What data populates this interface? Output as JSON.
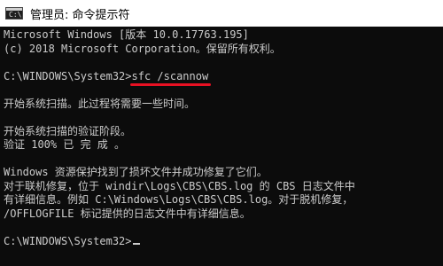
{
  "window": {
    "title": "管理员: 命令提示符",
    "icon": "console-icon",
    "icon_glyph": "C:\\"
  },
  "console": {
    "lines": [
      "Microsoft Windows [版本 10.0.17763.195]",
      "(c) 2018 Microsoft Corporation。保留所有权利。",
      "",
      "",
      "开始系统扫描。此过程将需要一些时间。",
      "",
      "开始系统扫描的验证阶段。",
      "验证 100% 已 完 成 。",
      "",
      "Windows 资源保护找到了损坏文件并成功修复了它们。",
      "对于联机修复，位于 windir\\Logs\\CBS\\CBS.log 的 CBS 日志文件中",
      "有详细信息。例如 C:\\Windows\\Logs\\CBS\\CBS.log。对于脱机修复，",
      "/OFFLOGFILE 标记提供的日志文件中有详细信息。",
      ""
    ],
    "command_prompt": "C:\\WINDOWS\\System32>",
    "command": "sfc /scannow",
    "final_prompt": "C:\\WINDOWS\\System32>"
  },
  "colors": {
    "background": "#0c0c0c",
    "text": "#cccccc",
    "highlight_underline": "#e81123",
    "titlebar": "#ffffff"
  }
}
